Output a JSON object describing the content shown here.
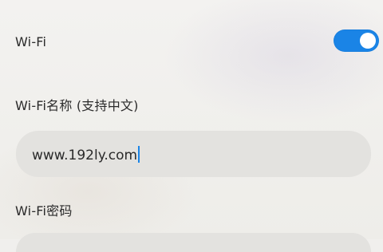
{
  "settings": {
    "wifi_toggle_label": "Wi-Fi",
    "wifi_enabled": true,
    "accent_color": "#1a84e6",
    "ssid_label": "Wi-Fi名称 (支持中文)",
    "ssid_value": "www.192ly.com",
    "password_label": "Wi-Fi密码"
  }
}
